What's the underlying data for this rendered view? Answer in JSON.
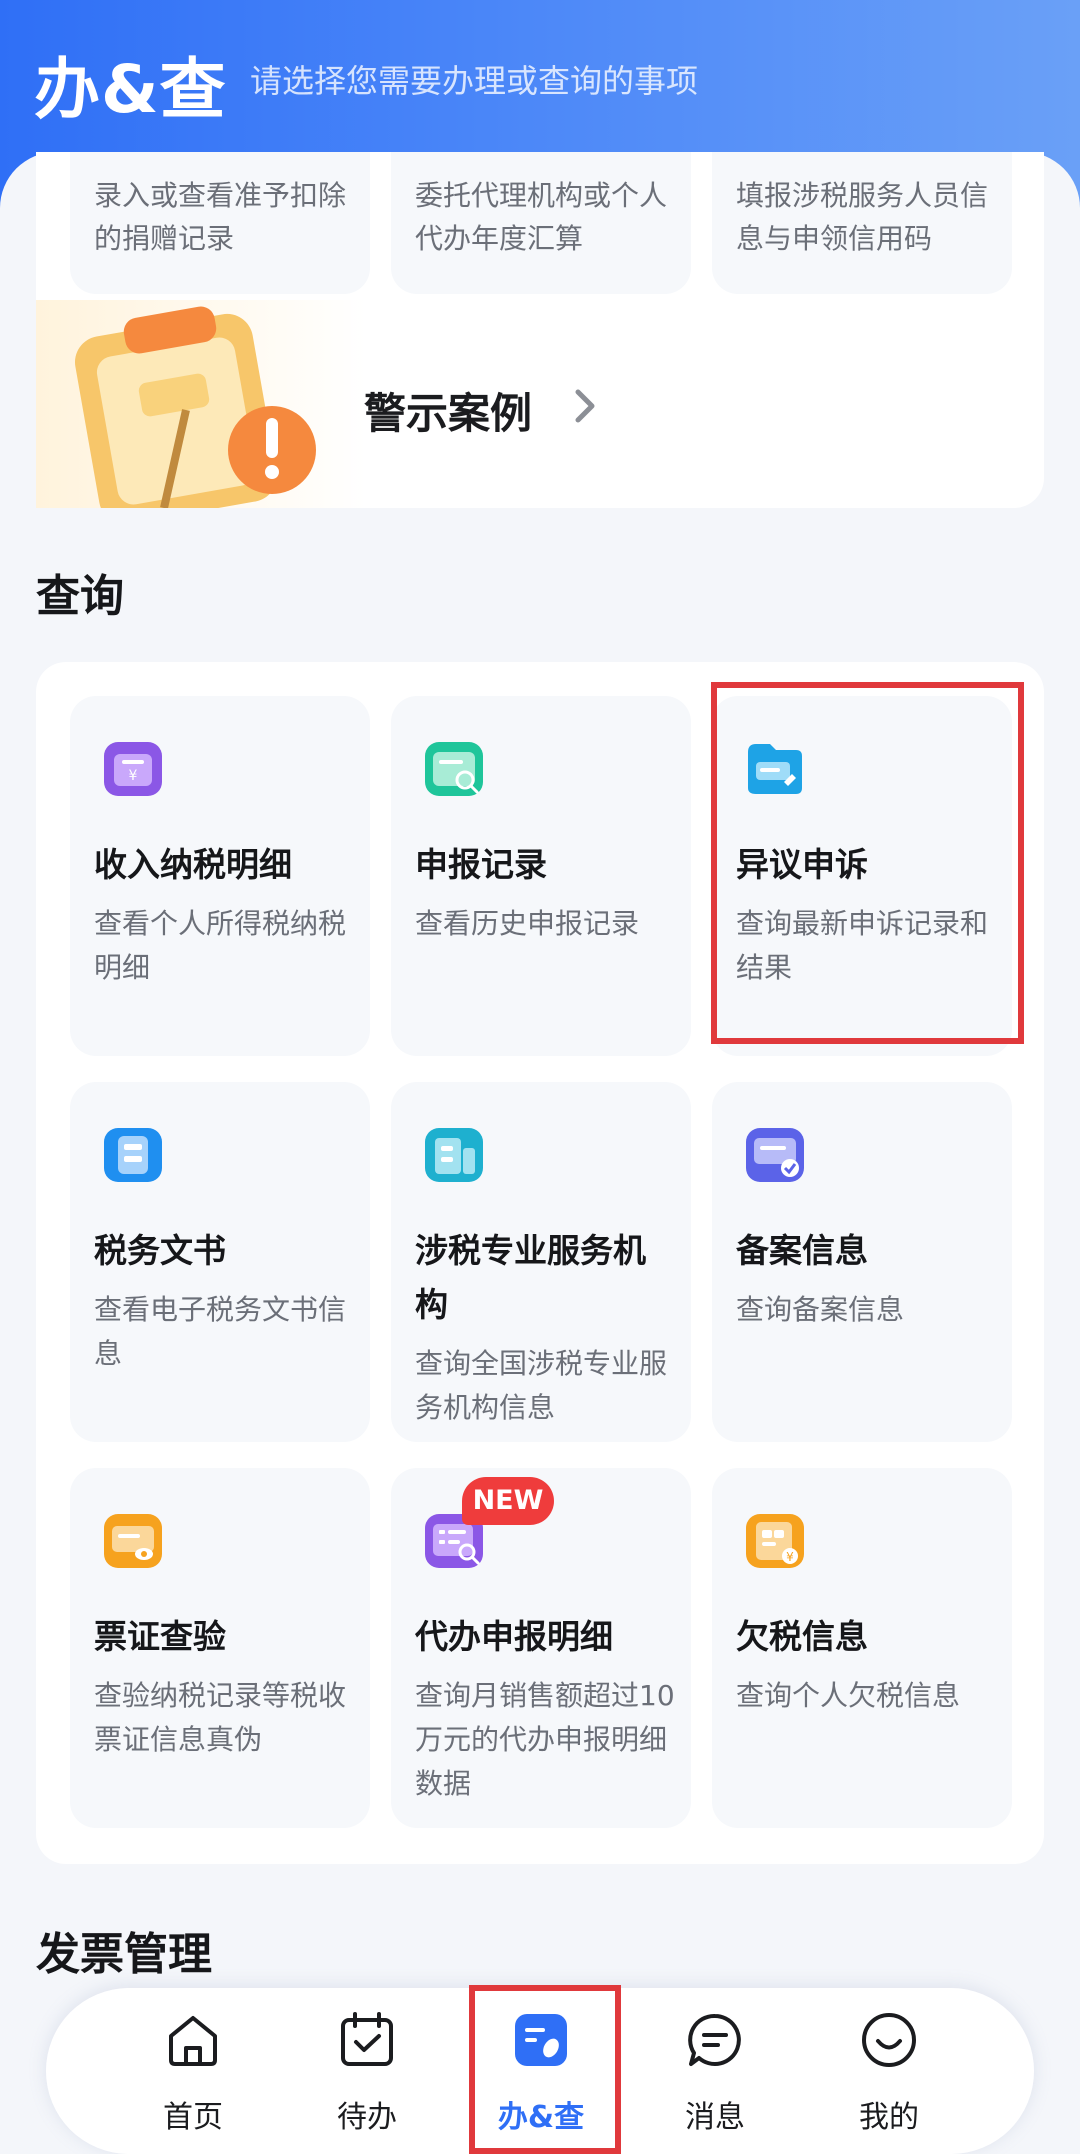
{
  "header": {
    "title": "办&查",
    "subtitle": "请选择您需要办理或查询的事项"
  },
  "top_cards": [
    {
      "desc": "录入或查看准予扣除的捐赠记录"
    },
    {
      "desc": "委托代理机构或个人代办年度汇算"
    },
    {
      "desc": "填报涉税服务人员信息与申领信用码"
    }
  ],
  "warning_banner": {
    "label": "警示案例"
  },
  "query_section": {
    "title": "查询",
    "cards": [
      {
        "title": "收入纳税明细",
        "desc": "查看个人所得税纳税明细",
        "icon": "income-detail-icon"
      },
      {
        "title": "申报记录",
        "desc": "查看历史申报记录",
        "icon": "declaration-record-icon"
      },
      {
        "title": "异议申诉",
        "desc": "查询最新申诉记录和结果",
        "icon": "appeal-icon"
      },
      {
        "title": "税务文书",
        "desc": "查看电子税务文书信息",
        "icon": "tax-document-icon"
      },
      {
        "title": "涉税专业服务机构",
        "desc": "查询全国涉税专业服务机构信息",
        "icon": "tax-service-agency-icon"
      },
      {
        "title": "备案信息",
        "desc": "查询备案信息",
        "icon": "filing-info-icon"
      },
      {
        "title": "票证查验",
        "desc": "查验纳税记录等税收票证信息真伪",
        "icon": "ticket-verify-icon"
      },
      {
        "title": "代办申报明细",
        "desc": "查询月销售额超过10万元的代办申报明细数据",
        "icon": "agent-declaration-icon",
        "badge": "NEW"
      },
      {
        "title": "欠税信息",
        "desc": "查询个人欠税信息",
        "icon": "tax-arrears-icon"
      }
    ]
  },
  "invoice_section": {
    "title": "发票管理"
  },
  "bottom_nav": {
    "items": [
      {
        "label": "首页",
        "icon": "home-icon"
      },
      {
        "label": "待办",
        "icon": "todo-calendar-icon"
      },
      {
        "label": "办&查",
        "icon": "handle-query-icon",
        "active": true
      },
      {
        "label": "消息",
        "icon": "message-icon"
      },
      {
        "label": "我的",
        "icon": "profile-icon"
      }
    ]
  },
  "colors": {
    "brand_blue": "#2f6ff6",
    "highlight_red": "#e0393c",
    "badge_red": "#ef3c3c"
  }
}
